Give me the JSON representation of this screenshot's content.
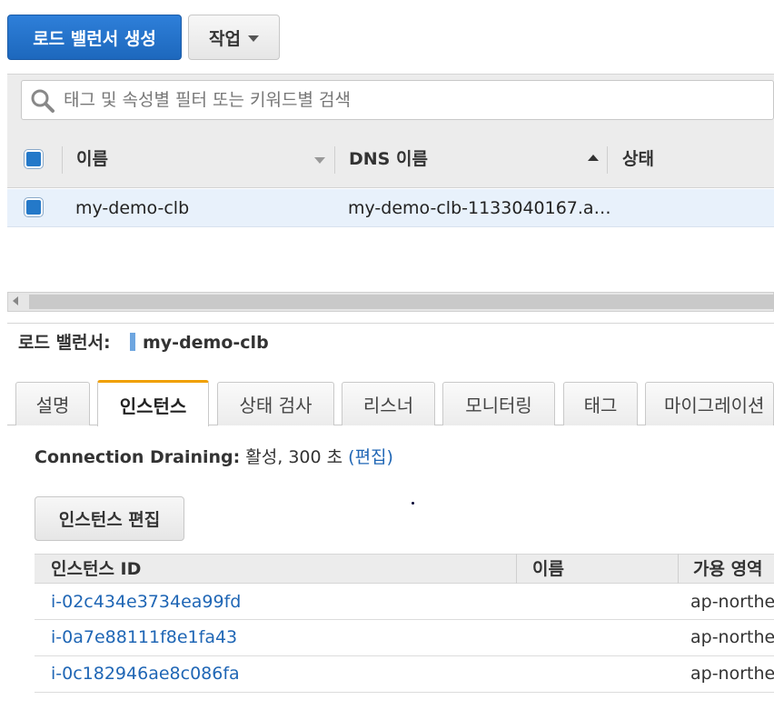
{
  "toolbar": {
    "create_label": "로드 밸런서 생성",
    "actions_label": "작업"
  },
  "search": {
    "placeholder": "태그 및 속성별 필터 또는 키워드별 검색"
  },
  "table": {
    "columns": [
      "이름",
      "DNS 이름",
      "상태"
    ],
    "rows": [
      {
        "name": "my-demo-clb",
        "dns": "my-demo-clb-1133040167.a…",
        "status": ""
      }
    ]
  },
  "detail": {
    "label": "로드 밸런서:",
    "name": "my-demo-clb",
    "tabs": [
      "설명",
      "인스턴스",
      "상태 검사",
      "리스너",
      "모니터링",
      "태그",
      "마이그레이션"
    ],
    "active_tab": "인스턴스",
    "connection_draining_label": "Connection Draining:",
    "connection_draining_value": "활성, 300 초",
    "edit_link": "(편집)",
    "edit_instances_label": "인스턴스 편집",
    "instances_columns": [
      "인스턴스 ID",
      "이름",
      "가용 영역"
    ],
    "instances": [
      {
        "id": "i-02c434e3734ea99fd",
        "name": "",
        "az": "ap-northea"
      },
      {
        "id": "i-0a7e88111f8e1fa43",
        "name": "",
        "az": "ap-northea"
      },
      {
        "id": "i-0c182946ae8c086fa",
        "name": "",
        "az": "ap-northea"
      }
    ]
  },
  "colors": {
    "primary": "#1d68bd",
    "link": "#1f66b5",
    "active_tab_accent": "#f0a000",
    "selected_row": "#e8f1fb"
  }
}
